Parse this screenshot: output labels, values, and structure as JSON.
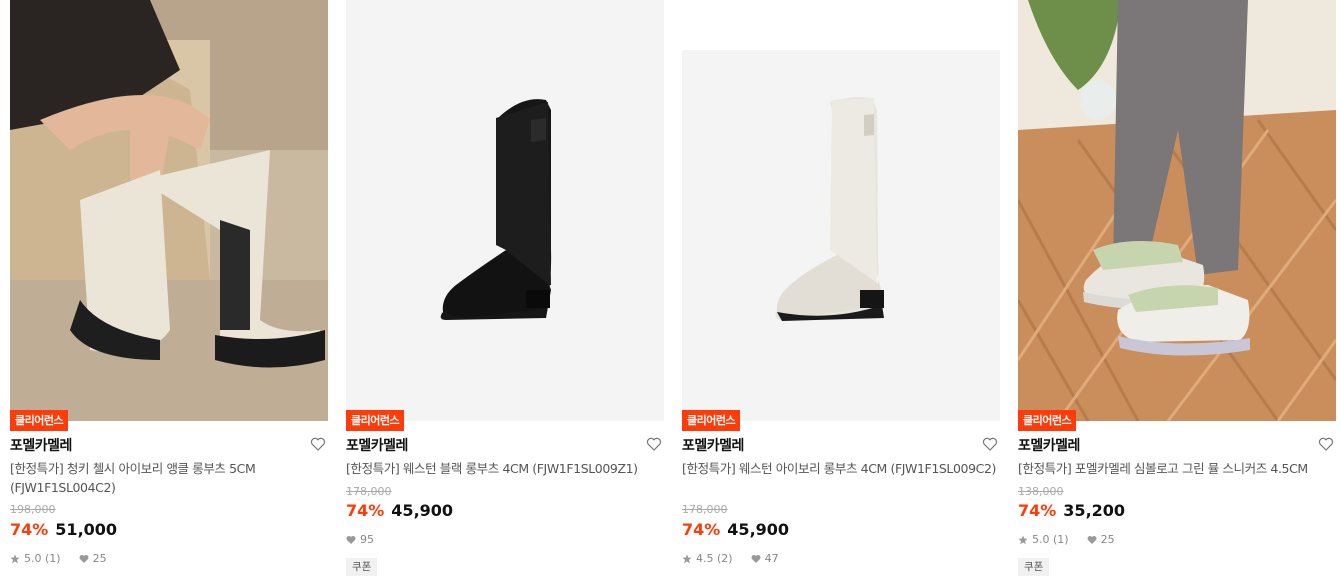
{
  "products": [
    {
      "badge": "클리어런스",
      "brand": "포멜카멜레",
      "name": "[한정특가] 청키 첼시 아이보리 앵클 롱부츠 5CM (FJW1F1SL004C2)",
      "original_price": "198,000",
      "discount": "74%",
      "price": "51,000",
      "rating": "5.0 (1)",
      "likes": "25",
      "coupon": "",
      "image": "ivory-chunky-chelsea-boots-lifestyle"
    },
    {
      "badge": "클리어런스",
      "brand": "포멜카멜레",
      "name": "[한정특가] 웨스턴 블랙 롱부츠 4CM (FJW1F1SL009Z1)",
      "original_price": "178,000",
      "discount": "74%",
      "price": "45,900",
      "rating": "",
      "likes": "95",
      "coupon": "쿠폰",
      "image": "black-western-long-boot"
    },
    {
      "badge": "클리어런스",
      "brand": "포멜카멜레",
      "name": "[한정특가] 웨스턴 아이보리 롱부츠 4CM (FJW1F1SL009C2)",
      "original_price": "178,000",
      "discount": "74%",
      "price": "45,900",
      "rating": "4.5 (2)",
      "likes": "47",
      "coupon": "",
      "image": "ivory-western-long-boot"
    },
    {
      "badge": "클리어런스",
      "brand": "포멜카멜레",
      "name": "[한정특가] 포멜카멜레 심볼로고 그린 뮬 스니커즈 4.5CM",
      "original_price": "138,000",
      "discount": "74%",
      "price": "35,200",
      "rating": "5.0 (1)",
      "likes": "25",
      "coupon": "쿠폰",
      "image": "green-mule-sneakers-lifestyle"
    }
  ],
  "colors": {
    "accent": "#ff3b0a",
    "text": "#111111",
    "muted": "#888888"
  },
  "icons": {
    "wishlist": "heart-outline-icon",
    "rating": "star-icon",
    "likes": "heart-icon"
  }
}
